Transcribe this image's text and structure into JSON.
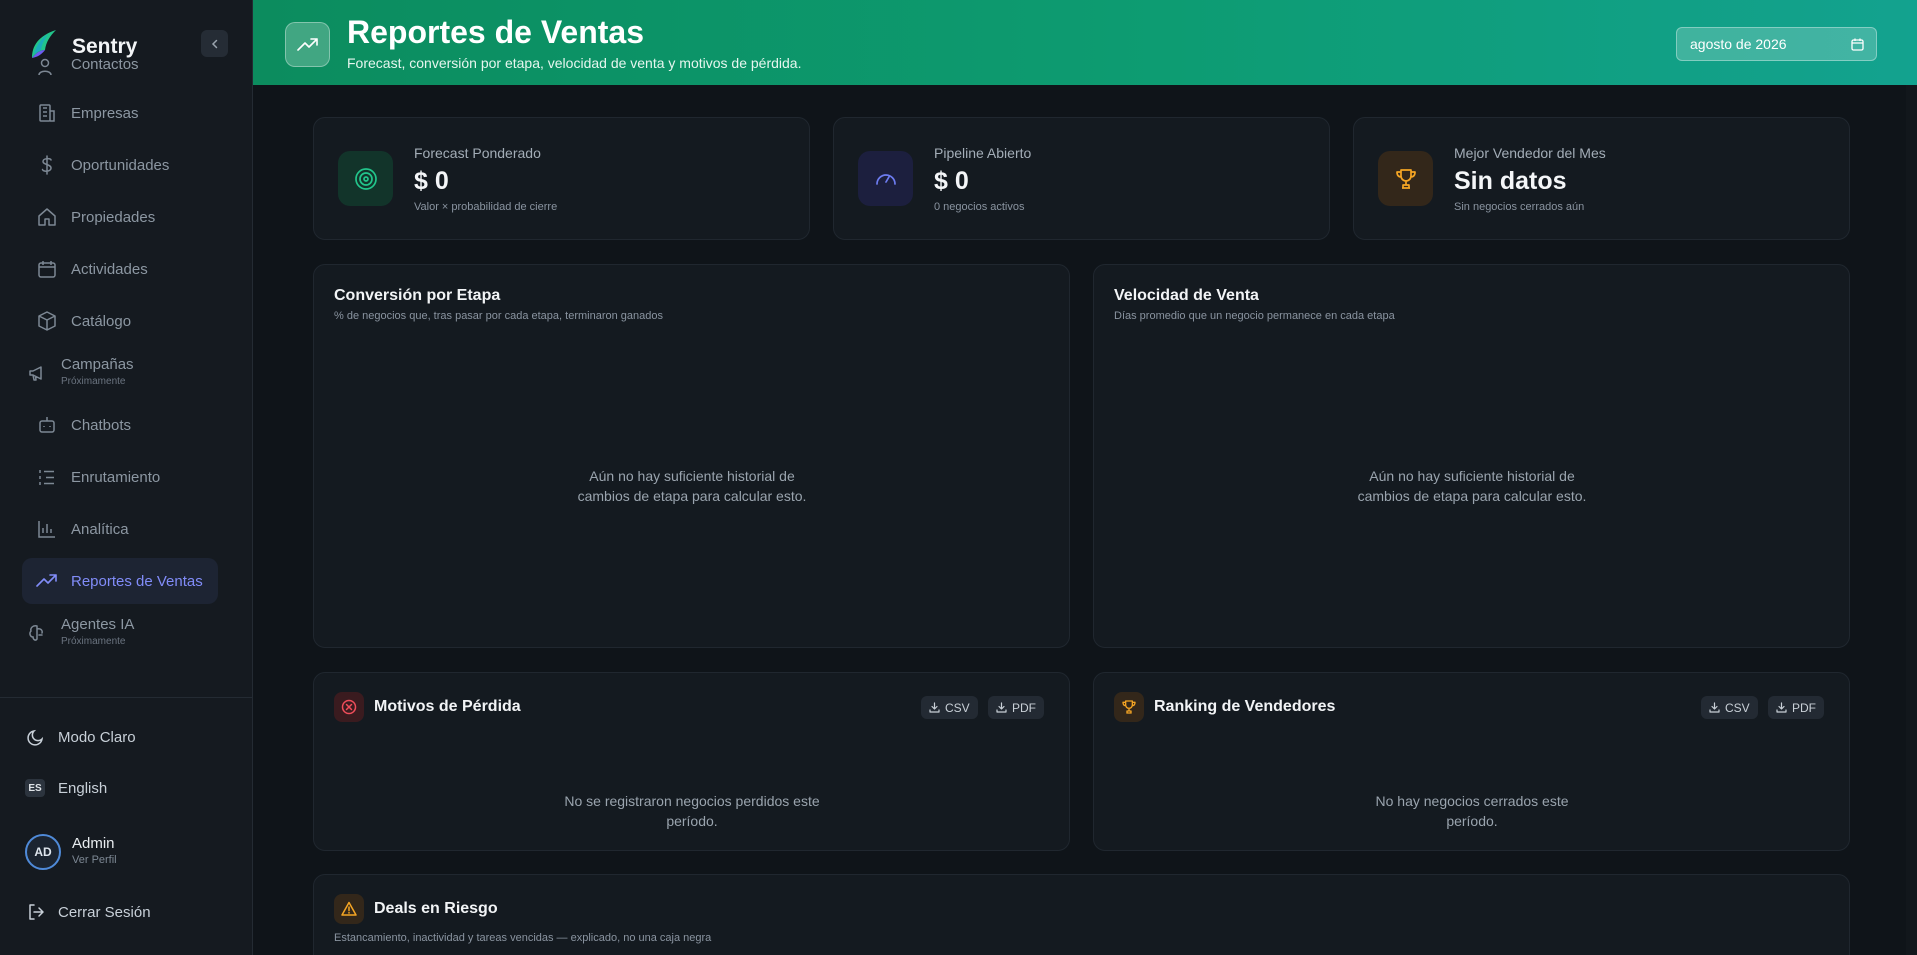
{
  "app": {
    "name": "Sentry"
  },
  "sidebar": {
    "items": [
      {
        "label": "Contactos",
        "icon": "users-icon"
      },
      {
        "label": "Empresas",
        "icon": "building-icon"
      },
      {
        "label": "Oportunidades",
        "icon": "dollar-icon"
      },
      {
        "label": "Propiedades",
        "icon": "home-icon"
      },
      {
        "label": "Actividades",
        "icon": "calendar-icon"
      },
      {
        "label": "Catálogo",
        "icon": "package-icon"
      },
      {
        "label": "Campañas",
        "sub": "Próximamente",
        "icon": "megaphone-icon"
      },
      {
        "label": "Chatbots",
        "icon": "bot-icon"
      },
      {
        "label": "Enrutamiento",
        "icon": "list-icon"
      },
      {
        "label": "Analítica",
        "icon": "bar-chart-icon"
      },
      {
        "label": "Reportes de Ventas",
        "icon": "trending-up-icon",
        "active": true
      },
      {
        "label": "Agentes IA",
        "sub": "Próximamente",
        "icon": "brain-icon"
      }
    ],
    "theme_label": "Modo Claro",
    "language_badge": "ES",
    "language_label": "English",
    "user": {
      "initials": "AD",
      "name": "Admin",
      "link": "Ver Perfil"
    },
    "logout_label": "Cerrar Sesión"
  },
  "header": {
    "title": "Reportes de Ventas",
    "subtitle": "Forecast, conversión por etapa, velocidad de venta y motivos de pérdida.",
    "date_value": "agosto de 2026"
  },
  "kpis": [
    {
      "label": "Forecast Ponderado",
      "value": "$ 0",
      "sub": "Valor × probabilidad de cierre",
      "icon": "target-icon",
      "color": "#22c58b"
    },
    {
      "label": "Pipeline Abierto",
      "value": "$ 0",
      "sub": "0 negocios activos",
      "icon": "gauge-icon",
      "color": "#6d7cf0"
    },
    {
      "label": "Mejor Vendedor del Mes",
      "value": "Sin datos",
      "sub": "Sin negocios cerrados aún",
      "icon": "trophy-icon",
      "color": "#f5a524"
    }
  ],
  "conversion": {
    "title": "Conversión por Etapa",
    "subtitle": "% de negocios que, tras pasar por cada etapa, terminaron ganados",
    "empty": "Aún no hay suficiente historial de cambios de etapa para calcular esto."
  },
  "velocity": {
    "title": "Velocidad de Venta",
    "subtitle": "Días promedio que un negocio permanece en cada etapa",
    "empty": "Aún no hay suficiente historial de cambios de etapa para calcular esto."
  },
  "loss": {
    "title": "Motivos de Pérdida",
    "csv": "CSV",
    "pdf": "PDF",
    "empty": "No se registraron negocios perdidos este período."
  },
  "ranking": {
    "title": "Ranking de Vendedores",
    "csv": "CSV",
    "pdf": "PDF",
    "empty": "No hay negocios cerrados este período."
  },
  "risk": {
    "title": "Deals en Riesgo",
    "subtitle": "Estancamiento, inactividad y tareas vencidas — explicado, no una caja negra"
  }
}
